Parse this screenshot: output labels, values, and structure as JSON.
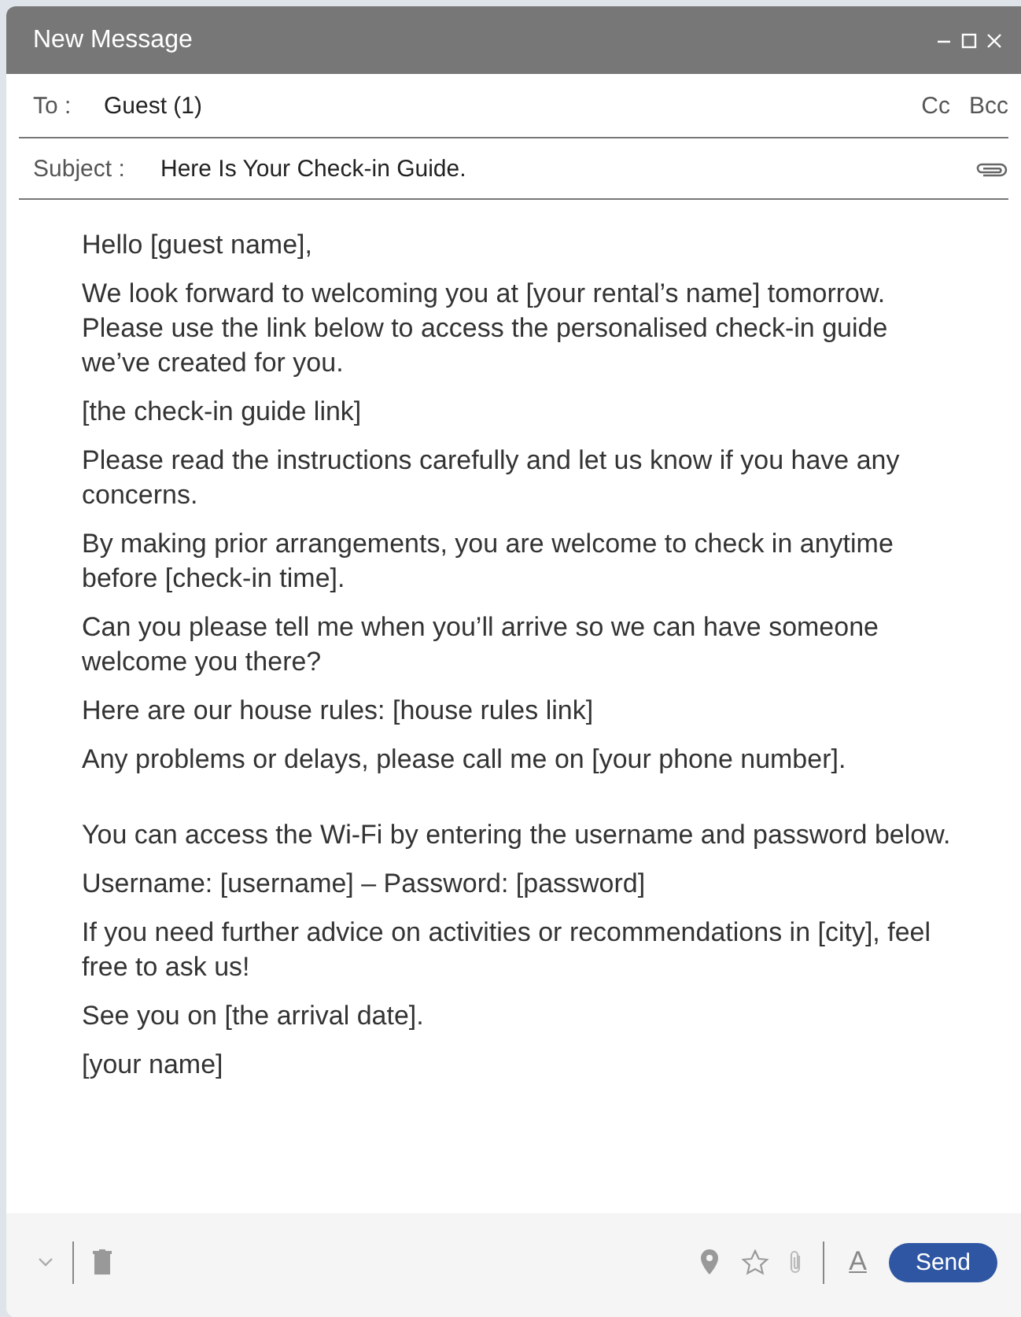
{
  "window": {
    "title": "New Message"
  },
  "to": {
    "label": "To :",
    "value": "Guest (1)",
    "cc": "Cc",
    "bcc": "Bcc"
  },
  "subject": {
    "label": "Subject :",
    "value": "Here Is Your Check-in Guide."
  },
  "body": {
    "sections": [
      [
        "Hello [guest name],",
        "We look forward to welcoming you at [your rental’s name] tomorrow. Please use the link below to access the personalised check-in guide we’ve created for you.",
        "[the check-in guide link]",
        "Please read the instructions carefully and let us know if you have any concerns.",
        "By making prior arrangements, you are welcome to check in anytime before [check-in time].",
        "Can you please tell me when you’ll arrive so we can have someone welcome you there?",
        "Here are our house rules: [house rules link]",
        "Any problems or delays, please call me on [your phone number]."
      ],
      [
        "You can access the Wi-Fi by entering the username and password below.",
        "Username: [username] – Password: [password]",
        "If you need further advice on activities or recommendations in [city], feel free to ask us!",
        "See you on [the arrival date].",
        "[your name]"
      ]
    ]
  },
  "toolbar": {
    "text_color": "A",
    "send": "Send"
  }
}
